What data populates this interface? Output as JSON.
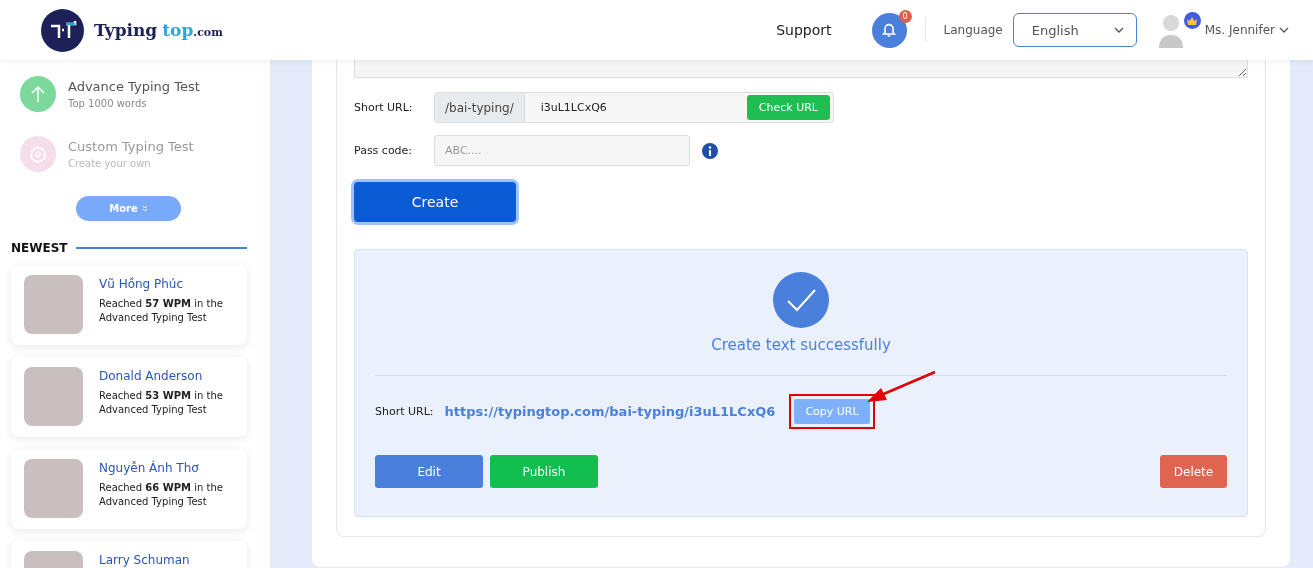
{
  "header": {
    "logo": [
      "Typing",
      "top",
      ".com"
    ],
    "support": "Support",
    "notifications": "0",
    "language_label": "Language",
    "language": "English",
    "user": "Ms. Jennifer"
  },
  "sidebar": {
    "items": [
      {
        "title": "Advance Typing Test",
        "subtitle": "Top 1000 words",
        "kind": "arrow",
        "disabled": false
      },
      {
        "title": "Custom Typing Test",
        "subtitle": "Create your own",
        "kind": "gear",
        "disabled": true
      }
    ],
    "more": "More",
    "newest_title": "NEWEST",
    "newest": [
      {
        "name": "Vũ Hồng Phúc",
        "text": "Reached **57 WPM** in the Advanced Typing Test"
      },
      {
        "name": "Donald Anderson",
        "text": "Reached **53 WPM** in the Advanced Typing Test"
      },
      {
        "name": "Nguyễn Ánh Thơ",
        "text": "Reached **66 WPM** in the Advanced Typing Test"
      },
      {
        "name": "Larry Schuman"
      }
    ]
  },
  "form": {
    "short_url_label": "Short URL:",
    "prefix": "/bai-typing/",
    "slug": "i3uL1LCxQ6",
    "check": "Check URL",
    "pass_label": "Pass code:",
    "pass_placeholder": "ABC....",
    "create": "Create"
  },
  "result": {
    "message": "Create text successfully",
    "url_label": "Short URL:",
    "url": "https://typingtop.com/bai-typing/i3uL1LCxQ6",
    "copy": "Copy URL",
    "highlighted": true,
    "buttons": [
      {
        "label": "Edit",
        "kind": "edit"
      },
      {
        "label": "Publish",
        "kind": "publish"
      },
      {
        "label": "Delete",
        "kind": "delete"
      }
    ]
  }
}
